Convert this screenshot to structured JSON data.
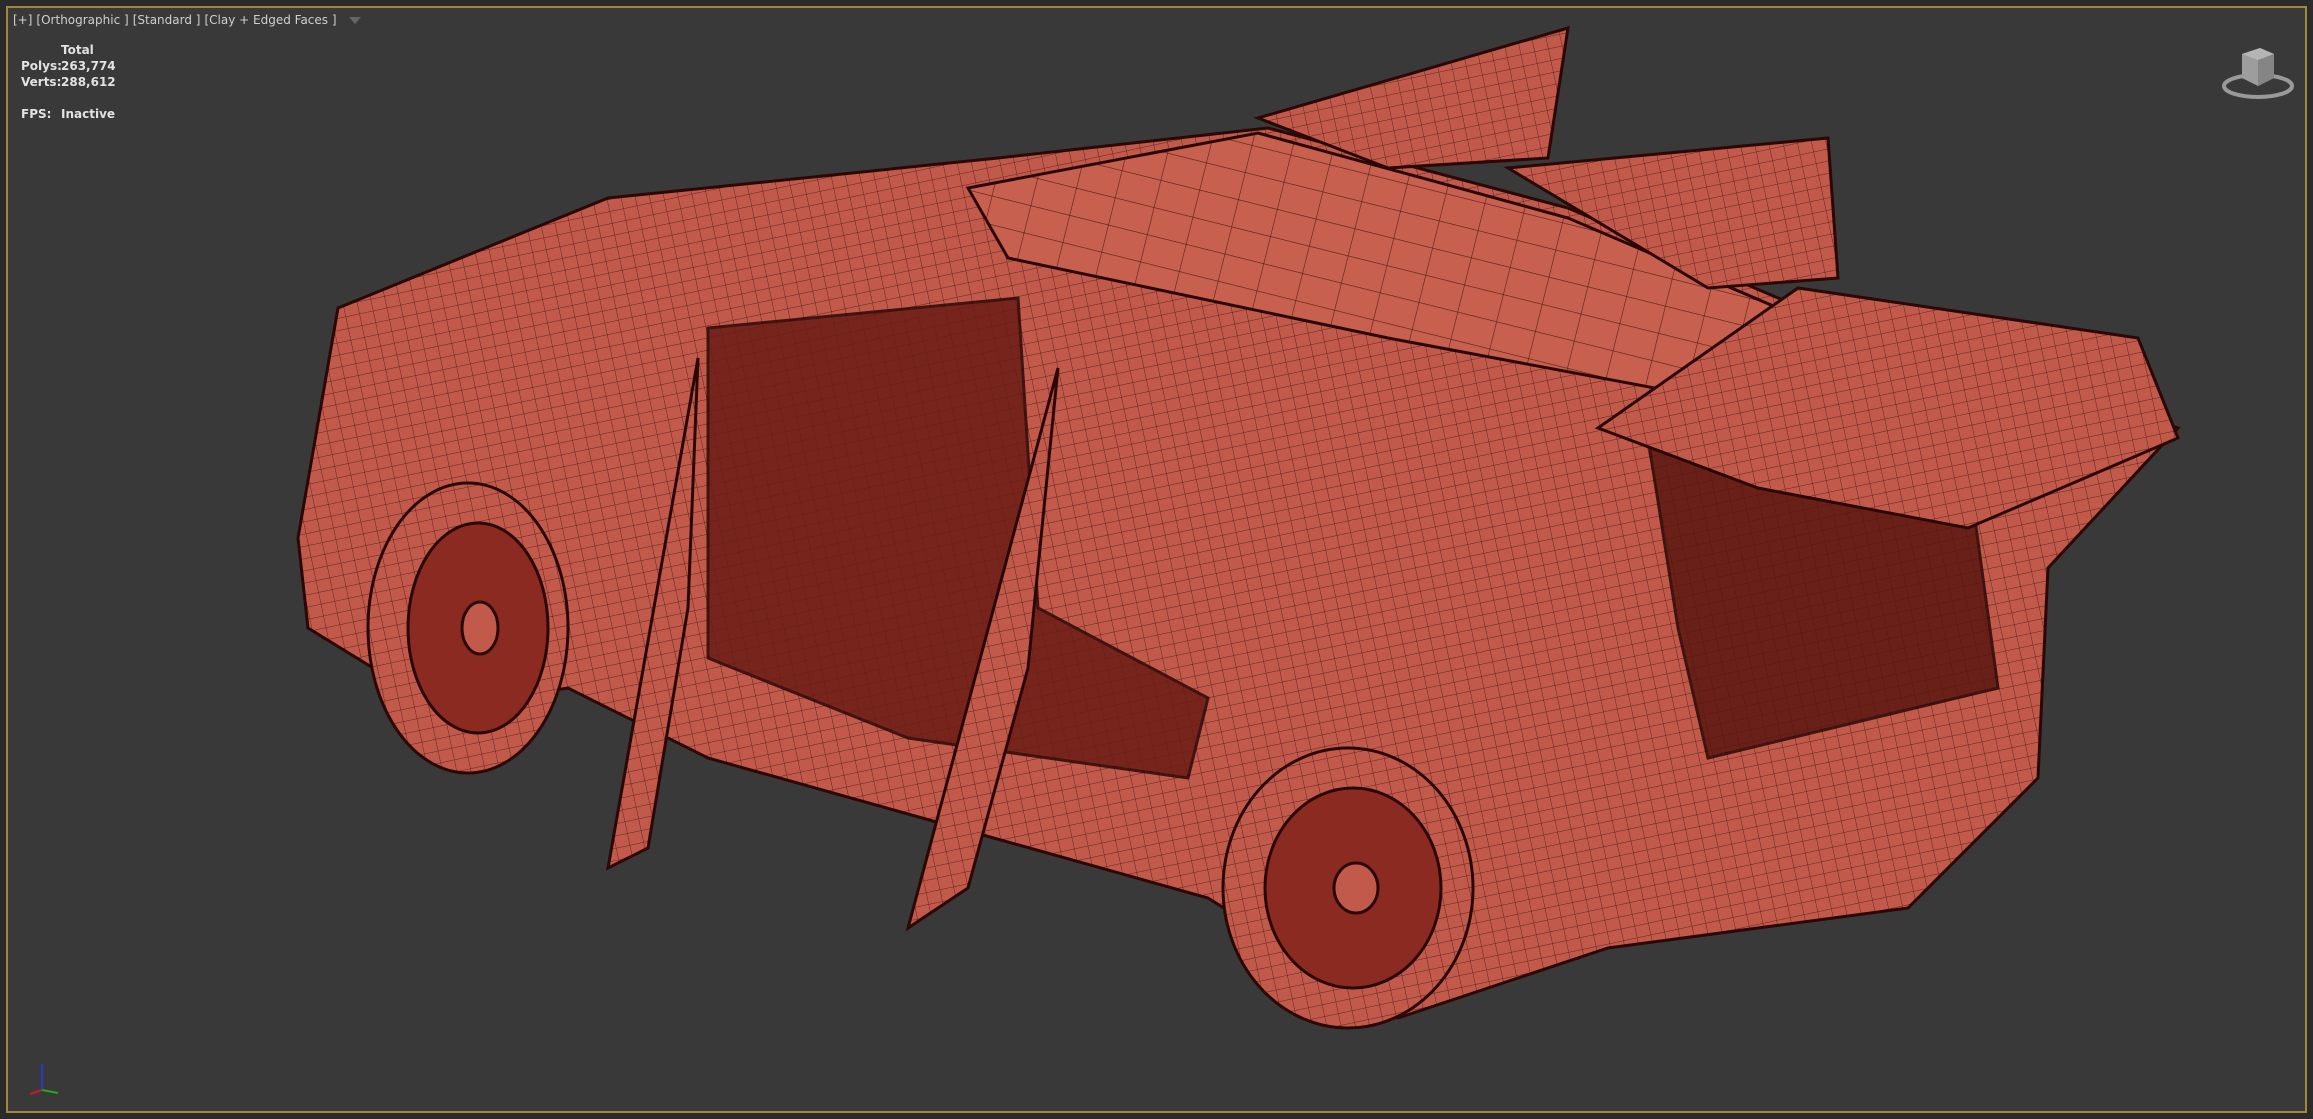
{
  "viewport": {
    "labels": [
      "[+]",
      "[Orthographic ]",
      "[Standard ]",
      "[Clay + Edged Faces ]"
    ],
    "stats": {
      "header": "Total",
      "polys_label": "Polys:",
      "polys_value": "263,774",
      "verts_label": "Verts:",
      "verts_value": "288,612",
      "fps_label": "FPS:",
      "fps_value": "Inactive"
    }
  },
  "colors": {
    "clay": "#c25a4c",
    "edge": "#3a0c08",
    "background": "#393939",
    "border": "#a08a3a"
  }
}
